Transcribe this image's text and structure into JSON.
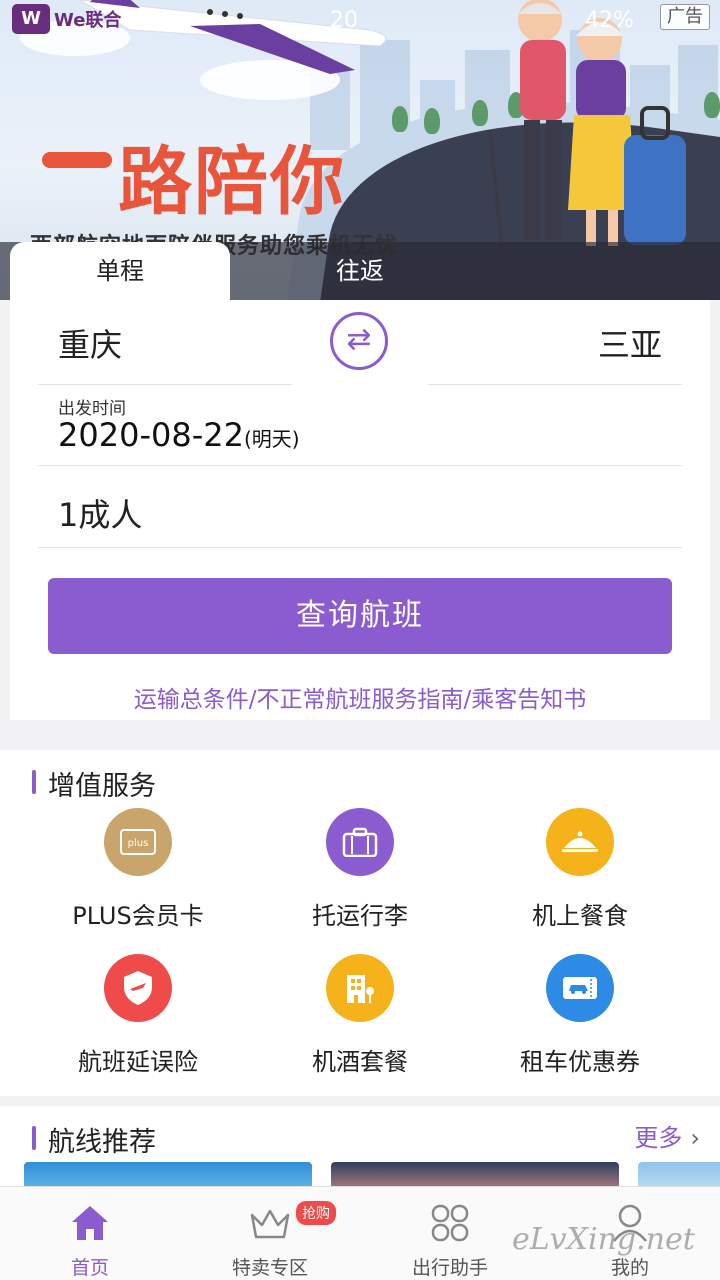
{
  "status_bar": {
    "time": "20",
    "battery": "42%",
    "brand_short": "W",
    "brand_text": "We联合"
  },
  "banner": {
    "slogan": "路陪你",
    "subtitle": "西部航空地面陪伴服务助您乘机无忧",
    "ad_label": "广告"
  },
  "trip_tabs": {
    "one_way": "单程",
    "round_trip": "往返"
  },
  "search": {
    "from_city": "重庆",
    "to_city": "三亚",
    "date_label": "出发时间",
    "date_value": "2020-08-22",
    "date_hint": "(明天)",
    "passengers": "1成人",
    "button": "查询航班",
    "terms": "运输总条件/不正常航班服务指南/乘客告知书"
  },
  "services": {
    "title": "增值服务",
    "items": [
      {
        "label": "PLUS会员卡",
        "icon": "plus-card-icon",
        "color": "#c9a46b"
      },
      {
        "label": "托运行李",
        "icon": "suitcase-icon",
        "color": "#8b5bd0"
      },
      {
        "label": "机上餐食",
        "icon": "meal-cloche-icon",
        "color": "#f5b21b"
      },
      {
        "label": "航班延误险",
        "icon": "shield-plane-icon",
        "color": "#ef4b4b"
      },
      {
        "label": "机酒套餐",
        "icon": "hotel-icon",
        "color": "#f5b21b"
      },
      {
        "label": "租车优惠券",
        "icon": "car-ticket-icon",
        "color": "#2d8be6"
      }
    ]
  },
  "routes": {
    "title": "航线推荐",
    "more": "更多"
  },
  "bottom_nav": [
    {
      "label": "首页",
      "icon": "home-icon",
      "active": true
    },
    {
      "label": "特卖专区",
      "icon": "crown-icon",
      "badge": "抢购"
    },
    {
      "label": "出行助手",
      "icon": "grid-icon"
    },
    {
      "label": "我的",
      "icon": "user-icon"
    }
  ],
  "watermark": "eLvXing.net",
  "colors": {
    "accent": "#8b5bd0",
    "slogan": "#e8553a"
  }
}
